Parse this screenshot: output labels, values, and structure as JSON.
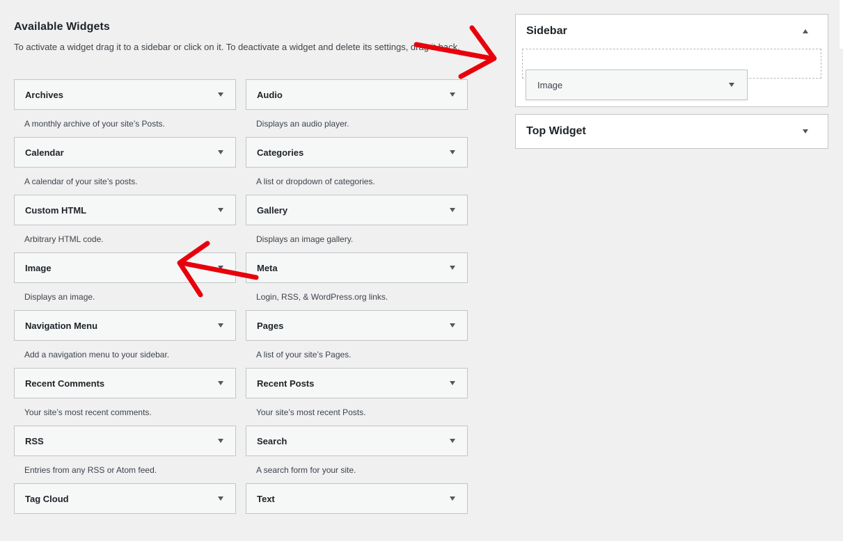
{
  "available": {
    "title": "Available Widgets",
    "description": "To activate a widget drag it to a sidebar or click on it. To deactivate a widget and delete its settings, drag it back."
  },
  "widgets": [
    {
      "name": "Archives",
      "desc": "A monthly archive of your site’s Posts."
    },
    {
      "name": "Audio",
      "desc": "Displays an audio player."
    },
    {
      "name": "Calendar",
      "desc": "A calendar of your site’s posts."
    },
    {
      "name": "Categories",
      "desc": "A list or dropdown of categories."
    },
    {
      "name": "Custom HTML",
      "desc": "Arbitrary HTML code."
    },
    {
      "name": "Gallery",
      "desc": "Displays an image gallery."
    },
    {
      "name": "Image",
      "desc": "Displays an image."
    },
    {
      "name": "Meta",
      "desc": "Login, RSS, & WordPress.org links."
    },
    {
      "name": "Navigation Menu",
      "desc": "Add a navigation menu to your sidebar."
    },
    {
      "name": "Pages",
      "desc": "A list of your site’s Pages."
    },
    {
      "name": "Recent Comments",
      "desc": "Your site’s most recent comments."
    },
    {
      "name": "Recent Posts",
      "desc": "Your site’s most recent Posts."
    },
    {
      "name": "RSS",
      "desc": "Entries from any RSS or Atom feed."
    },
    {
      "name": "Search",
      "desc": "A search form for your site."
    },
    {
      "name": "Tag Cloud",
      "desc": ""
    },
    {
      "name": "Text",
      "desc": ""
    }
  ],
  "sidebar": {
    "title": "Sidebar",
    "dragging_widget": "Image"
  },
  "top_widget": {
    "title": "Top Widget"
  },
  "colors": {
    "annotation_arrow": "#e8000b",
    "background": "#f0f0f1"
  },
  "icons": {
    "toggle_closed": "triangle-down",
    "toggle_open": "triangle-up"
  }
}
